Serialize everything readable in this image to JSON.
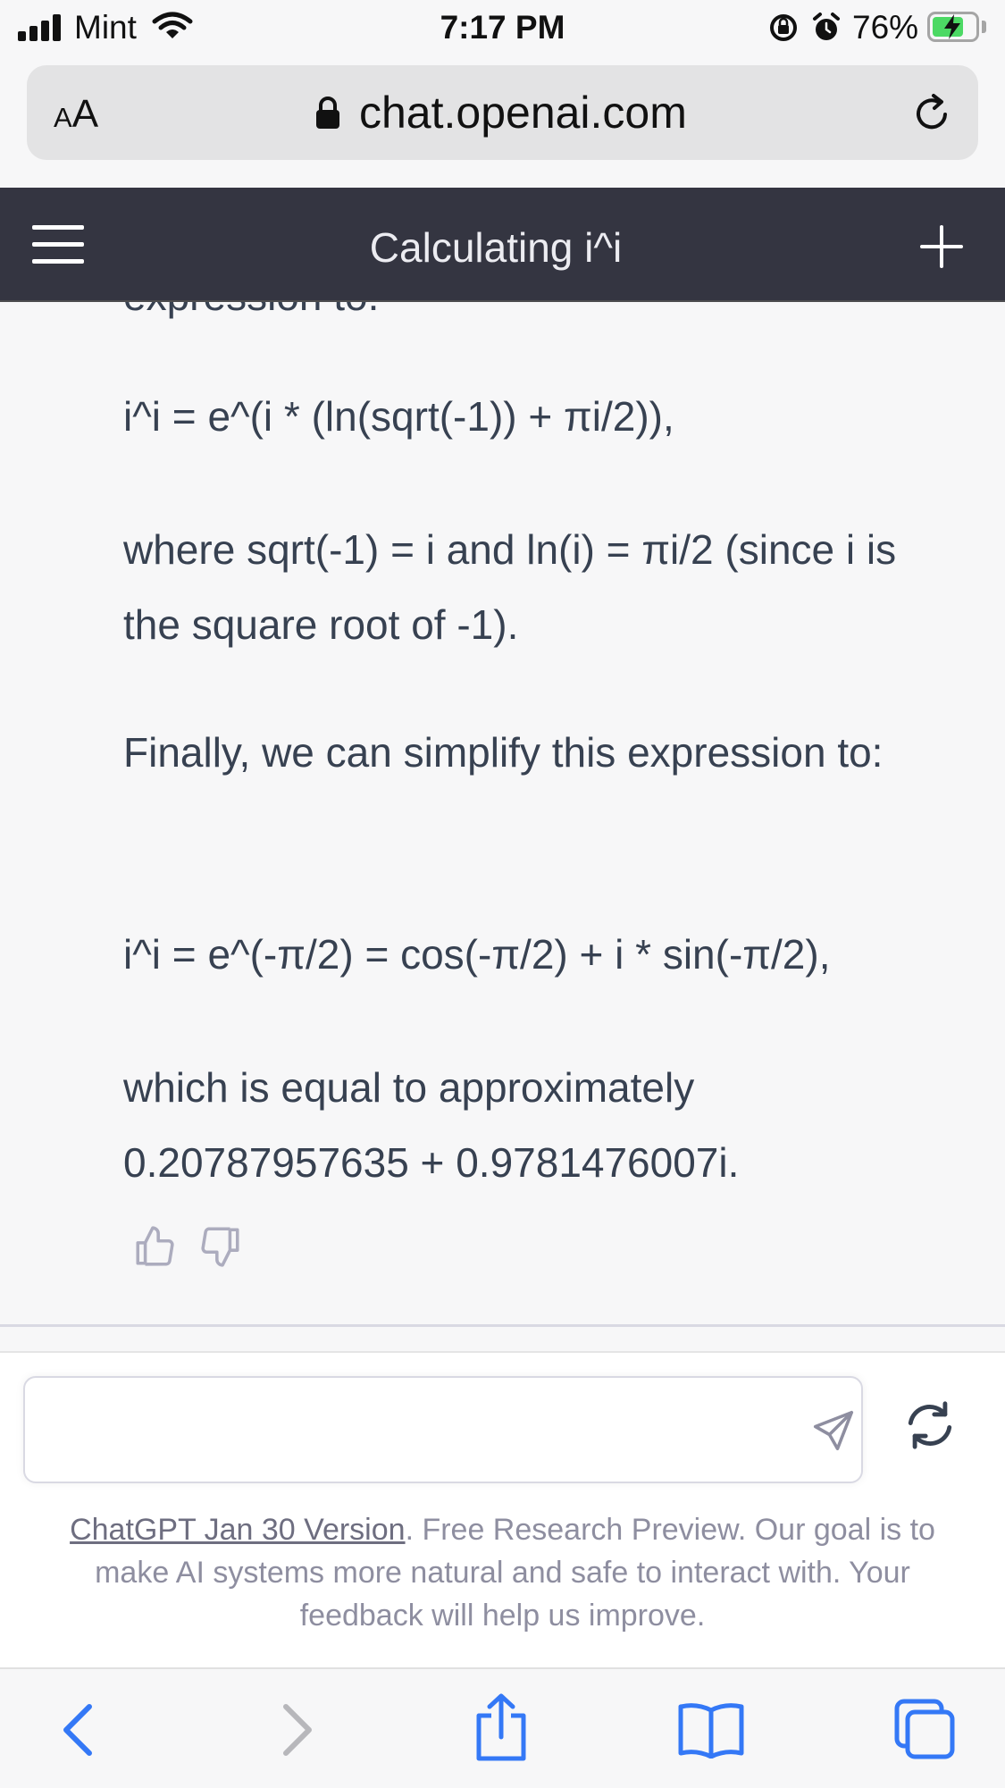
{
  "status_bar": {
    "carrier": "Mint",
    "time": "7:17 PM",
    "battery_percent": "76%",
    "battery_level": 0.76,
    "icons": [
      "cellular-signal-icon",
      "wifi-icon",
      "orientation-lock-icon",
      "alarm-icon",
      "battery-charging-icon"
    ]
  },
  "browser": {
    "text_size_label_small": "A",
    "text_size_label_large": "A",
    "url": "chat.openai.com",
    "icons": [
      "lock-icon",
      "reload-icon"
    ]
  },
  "app_header": {
    "title": "Calculating i^i",
    "icons": [
      "menu-icon",
      "new-chat-plus-icon"
    ]
  },
  "message": {
    "cut_off_line": "expression to:",
    "paragraphs": [
      "i^i = e^(i * (ln(sqrt(-1)) + πi/2)),",
      "where sqrt(-1) = i and ln(i) = πi/2 (since i is the square root of -1).",
      "Finally, we can simplify this expression to:",
      "i^i = e^(-π/2) = cos(-π/2) + i * sin(-π/2),",
      "which is equal to approximately 0.20787957635 + 0.9781476007i."
    ],
    "feedback_icons": [
      "thumbs-up-icon",
      "thumbs-down-icon"
    ]
  },
  "composer": {
    "value": "",
    "placeholder": "",
    "icons": [
      "send-icon",
      "regenerate-icon"
    ]
  },
  "footer": {
    "version_link": "ChatGPT Jan 30 Version",
    "note": ". Free Research Preview. Our goal is to make AI systems more natural and safe to interact with. Your feedback will help us improve."
  },
  "safari_toolbar": {
    "icons": [
      "back-icon",
      "forward-icon",
      "share-icon",
      "bookmarks-icon",
      "tabs-icon"
    ]
  },
  "colors": {
    "header_bg": "#343541",
    "page_bg": "#f7f7f8",
    "text": "#374151",
    "ios_blue": "#3478f6",
    "battery_green": "#4cd964"
  }
}
